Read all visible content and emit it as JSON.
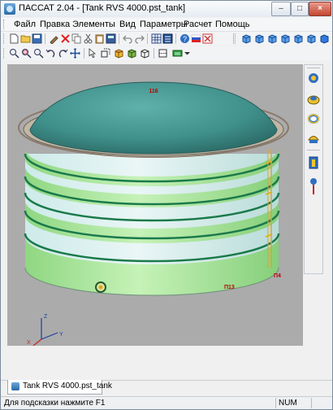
{
  "window": {
    "title": "ПАССАТ 2.04 - [Tank RVS 4000.pst_tank]",
    "controls": {
      "minimize": "–",
      "maximize": "□",
      "close": "×"
    }
  },
  "menu": [
    "Файл",
    "Правка",
    "Элементы",
    "Вид",
    "Параметры",
    "Расчет",
    "Помощь"
  ],
  "toolbar1": {
    "left_icons": [
      "new-file-icon",
      "open-folder-icon",
      "save-icon",
      "properties-icon",
      "delete-icon",
      "copy-icon",
      "cut-icon",
      "paste-icon",
      "calculator-icon",
      "undo-icon",
      "redo-icon",
      "table-icon",
      "table-edit-icon",
      "help-icon",
      "language-ru-icon",
      "report-icon"
    ],
    "view_cubes": [
      "view-front-icon",
      "view-back-icon",
      "view-top-icon",
      "view-bottom-icon",
      "view-left-icon",
      "view-right-icon",
      "view-iso-icon"
    ]
  },
  "toolbar2": {
    "icons": [
      "zoom-icon",
      "zoom-window-icon",
      "zoom-extents-icon",
      "rotate-ccw-icon",
      "rotate-cw-icon",
      "pan-icon",
      "select-icon",
      "shaded-cube-icon",
      "wireframe-cube-icon",
      "perspective-icon",
      "section-icon",
      "display-mode-icon"
    ]
  },
  "viewport": {
    "labels": {
      "top": "116",
      "side": "П4",
      "base": "П13"
    },
    "axis": {
      "z": "Z",
      "y": "Y",
      "x": "X"
    }
  },
  "right_toolbar": [
    "nozzle-icon",
    "ring-icon",
    "ring-stiffener-icon",
    "roof-icon",
    "support-icon",
    "probe-icon"
  ],
  "tabs": [
    {
      "label": "Tank RVS 4000.pst_tank"
    }
  ],
  "status": {
    "hint": "Для подсказки нажмите F1",
    "num": "NUM"
  },
  "colors": {
    "tank_green": "#a8e59a",
    "tank_shell": "#d9eeee",
    "roof": "#3f8f8a",
    "ring": "#1a7a4a",
    "viewport_bg": "#ababab"
  }
}
